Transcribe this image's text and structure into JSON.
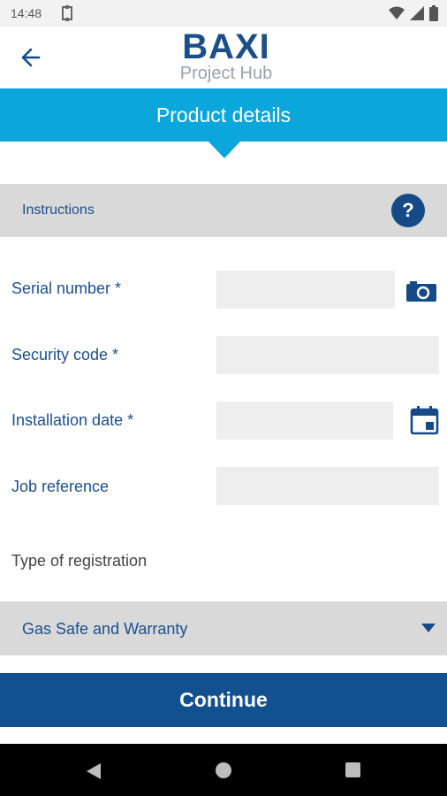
{
  "status_bar": {
    "time": "14:48"
  },
  "header": {
    "brand_name": "BAXI",
    "brand_subtitle": "Project Hub"
  },
  "banner": {
    "title": "Product details"
  },
  "instructions": {
    "label": "Instructions",
    "help_glyph": "?"
  },
  "form": {
    "fields": [
      {
        "label": "Serial number *",
        "value": "",
        "placeholder": ""
      },
      {
        "label": "Security code *",
        "value": "",
        "placeholder": ""
      },
      {
        "label": "Installation date *",
        "value": "",
        "placeholder": ""
      },
      {
        "label": "Job reference",
        "value": "",
        "placeholder": ""
      }
    ],
    "registration_label": "Type of registration",
    "registration_value": "Gas Safe and Warranty"
  },
  "actions": {
    "continue_label": "Continue"
  },
  "colors": {
    "banner": "#0aa6dc",
    "primary": "#12508f",
    "text_blue": "#1d4f8a",
    "bar_grey": "#d9d9d9"
  },
  "icons": {
    "back": "arrow-left-icon",
    "help": "help-icon",
    "camera": "camera-icon",
    "calendar": "calendar-icon",
    "caret": "caret-down-icon"
  }
}
